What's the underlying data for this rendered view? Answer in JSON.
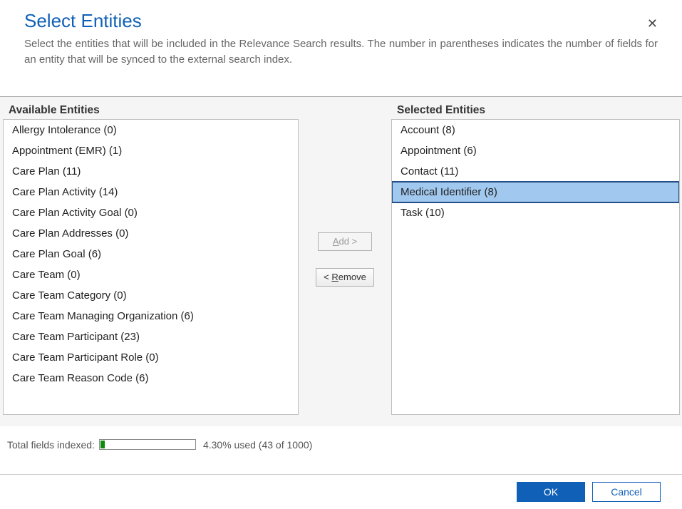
{
  "header": {
    "title": "Select Entities",
    "description": "Select the entities that will be included in the Relevance Search results. The number in parentheses indicates the number of fields for an entity that will be synced to the external search index."
  },
  "labels": {
    "available": "Available Entities",
    "selected": "Selected Entities",
    "add": "Add >",
    "remove_prefix": "< ",
    "remove_word": "Remove"
  },
  "available": [
    {
      "label": "Allergy Intolerance (0)"
    },
    {
      "label": "Appointment (EMR) (1)"
    },
    {
      "label": "Care Plan (11)"
    },
    {
      "label": "Care Plan Activity (14)"
    },
    {
      "label": "Care Plan Activity Goal (0)"
    },
    {
      "label": "Care Plan Addresses (0)"
    },
    {
      "label": "Care Plan Goal (6)"
    },
    {
      "label": "Care Team (0)"
    },
    {
      "label": "Care Team Category (0)"
    },
    {
      "label": "Care Team Managing Organization (6)"
    },
    {
      "label": "Care Team Participant (23)"
    },
    {
      "label": "Care Team Participant Role (0)"
    },
    {
      "label": "Care Team Reason Code (6)"
    }
  ],
  "selected": [
    {
      "label": "Account (8)"
    },
    {
      "label": "Appointment (6)"
    },
    {
      "label": "Contact (11)"
    },
    {
      "label": "Medical Identifier (8)",
      "selected": true
    },
    {
      "label": "Task (10)"
    }
  ],
  "status": {
    "label": "Total fields indexed:",
    "percent": 4.3,
    "usage_text": "4.30% used (43 of 1000)"
  },
  "footer": {
    "ok": "OK",
    "cancel": "Cancel"
  }
}
